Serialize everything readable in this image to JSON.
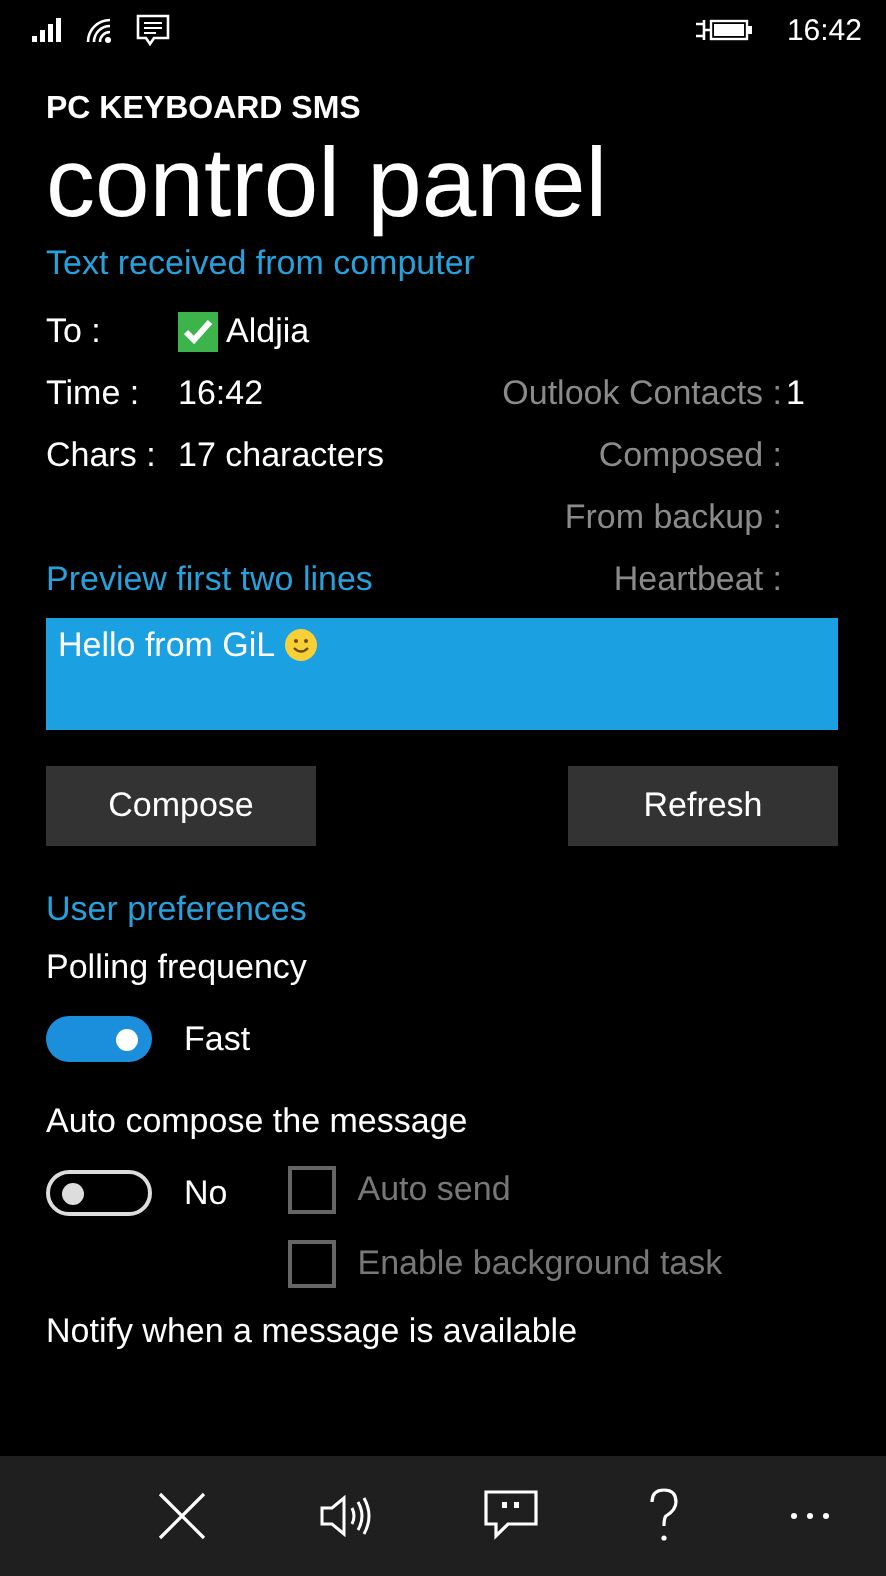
{
  "status_bar": {
    "time": "16:42"
  },
  "app": {
    "name": "PC KEYBOARD SMS",
    "title": "control panel"
  },
  "received": {
    "header": "Text received from computer",
    "rows": [
      {
        "label": "To :",
        "value": "Aldjia",
        "checked": true
      },
      {
        "label": "Time :",
        "value": "16:42"
      },
      {
        "label": "Chars :",
        "value": "17 characters"
      }
    ],
    "stats": [
      {
        "label": "Outlook Contacts :",
        "value": "1"
      },
      {
        "label": "Composed :"
      },
      {
        "label": "From backup :"
      },
      {
        "label": "Heartbeat :"
      }
    ],
    "preview_label": "Preview first two lines",
    "preview_text": "Hello from GiL"
  },
  "buttons": [
    "Compose",
    "Refresh"
  ],
  "preferences": {
    "header": "User preferences",
    "polling": {
      "label": "Polling frequency",
      "on": true,
      "state_text": "Fast"
    },
    "auto_compose": {
      "label": "Auto compose the message",
      "on": false,
      "state_text": "No"
    },
    "options": [
      {
        "label": "Auto send",
        "checked": false,
        "disabled": true
      },
      {
        "label": "Enable background task",
        "checked": false,
        "disabled": true
      }
    ],
    "notify_label": "Notify when a message is available"
  },
  "app_bar": [
    {
      "kind": "close"
    },
    {
      "kind": "speaker"
    },
    {
      "kind": "chat"
    },
    {
      "kind": "help"
    },
    {
      "kind": "more"
    }
  ]
}
